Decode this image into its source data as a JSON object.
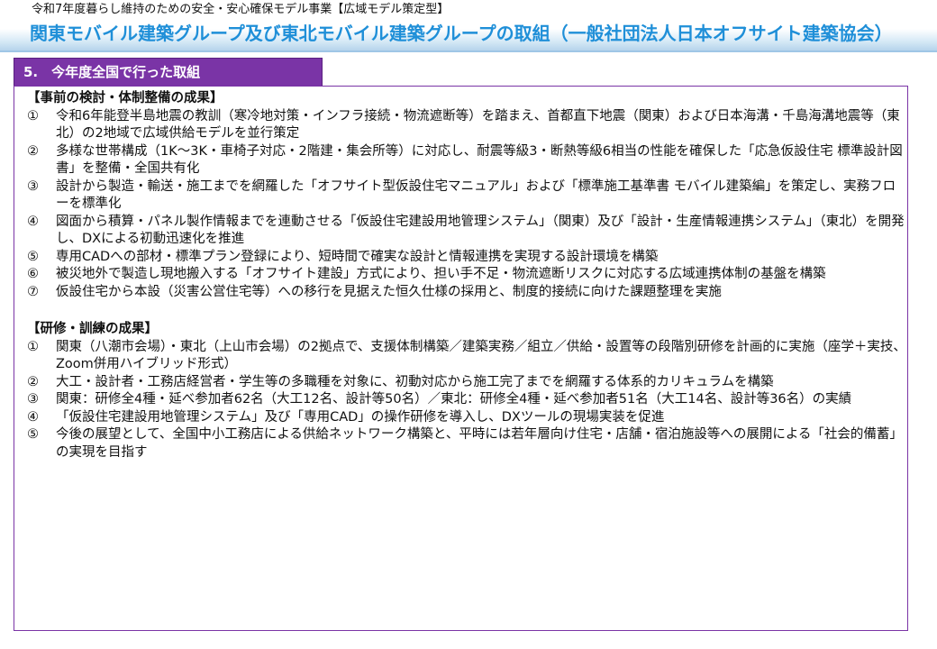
{
  "header": {
    "subtitle": "令和7年度暮らし維持のための安全・安心確保モデル事業【広域モデル策定型】",
    "title": "関東モバイル建築グループ及び東北モバイル建築グループの取組（一般社団法人日本オフサイト建築協会）"
  },
  "section": {
    "label": "5.　今年度全国で行った取組"
  },
  "groups": [
    {
      "title": "【事前の検討・体制整備の成果】",
      "items": [
        {
          "num": "①",
          "text": "令和6年能登半島地震の教訓（寒冷地対策・インフラ接続・物流遮断等）を踏まえ、首都直下地震（関東）および日本海溝・千島海溝地震等（東北）の2地域で広域供給モデルを並行策定"
        },
        {
          "num": "②",
          "text": "多様な世帯構成（1K～3K・車椅子対応・2階建・集会所等）に対応し、耐震等級3・断熱等級6相当の性能を確保した「応急仮設住宅 標準設計図書」を整備・全国共有化"
        },
        {
          "num": "③",
          "text": "設計から製造・輸送・施工までを網羅した「オフサイト型仮設住宅マニュアル」および「標準施工基準書 モバイル建築編」を策定し、実務フローを標準化"
        },
        {
          "num": "④",
          "text": "図面から積算・パネル製作情報までを連動させる「仮設住宅建設用地管理システム」（関東）及び「設計・生産情報連携システム」（東北）を開発し、DXによる初動迅速化を推進"
        },
        {
          "num": "⑤",
          "text": "専用CADへの部材・標準プラン登録により、短時間で確実な設計と情報連携を実現する設計環境を構築"
        },
        {
          "num": "⑥",
          "text": "被災地外で製造し現地搬入する「オフサイト建設」方式により、担い手不足・物流遮断リスクに対応する広域連携体制の基盤を構築"
        },
        {
          "num": "⑦",
          "text": "仮設住宅から本設（災害公営住宅等）への移行を見据えた恒久仕様の採用と、制度的接続に向けた課題整理を実施"
        }
      ]
    },
    {
      "title": "【研修・訓練の成果】",
      "items": [
        {
          "num": "①",
          "text": "関東（八潮市会場）・東北（上山市会場）の2拠点で、支援体制構築／建築実務／組立／供給・設置等の段階別研修を計画的に実施（座学＋実技、Zoom併用ハイブリッド形式）"
        },
        {
          "num": "②",
          "text": "大工・設計者・工務店経営者・学生等の多職種を対象に、初動対応から施工完了までを網羅する体系的カリキュラムを構築"
        },
        {
          "num": "③",
          "text": "関東：研修全4種・延べ参加者62名（大工12名、設計等50名）／東北：研修全4種・延べ参加者51名（大工14名、設計等36名）の実績"
        },
        {
          "num": "④",
          "text": "「仮設住宅建設用地管理システム」及び「専用CAD」の操作研修を導入し、DXツールの現場実装を促進"
        },
        {
          "num": "⑤",
          "text": "今後の展望として、全国中小工務店による供給ネットワーク構築と、平時には若年層向け住宅・店舗・宿泊施設等への展開による「社会的備蓄」の実現を目指す"
        }
      ]
    }
  ]
}
